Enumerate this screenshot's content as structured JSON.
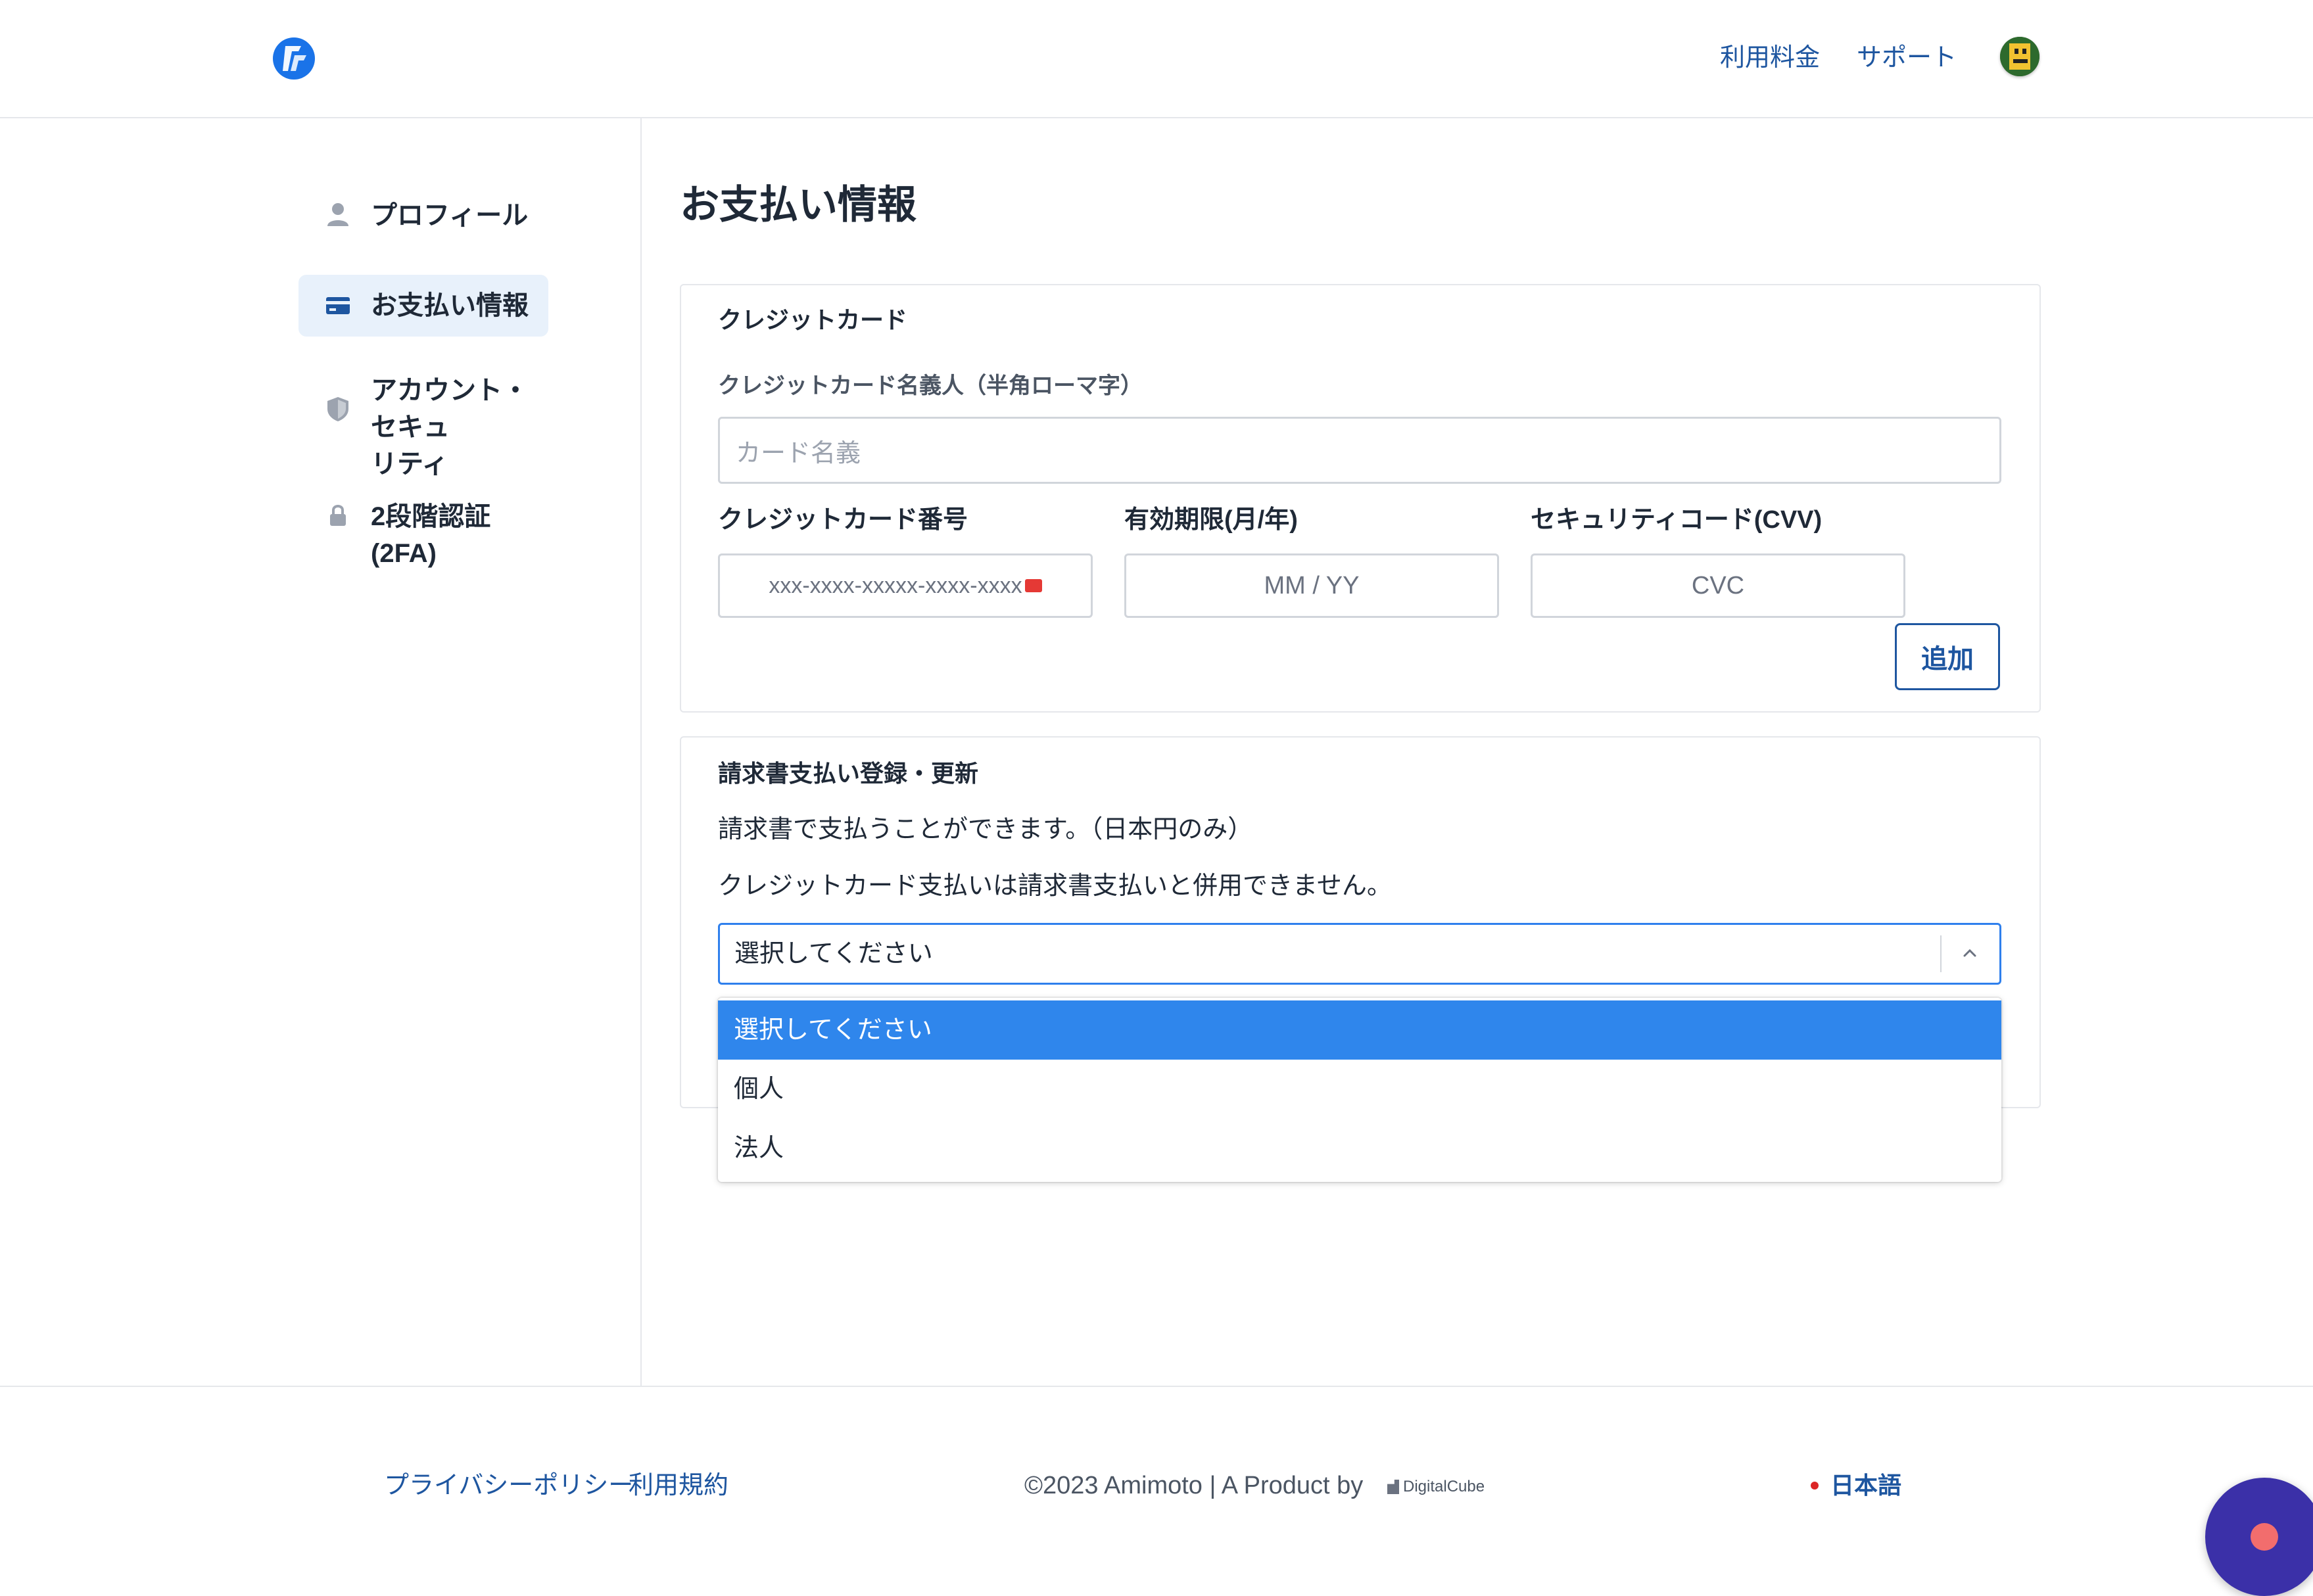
{
  "header": {
    "nav": [
      {
        "label": "利用料金"
      },
      {
        "label": "サポート"
      }
    ]
  },
  "sidebar": {
    "items": [
      {
        "label": "プロフィール",
        "icon": "user-icon",
        "active": false
      },
      {
        "label": "お支払い情報",
        "icon": "credit-card-icon",
        "active": true
      },
      {
        "label": "アカウント・セキュリティ",
        "line1": "アカウント・セキュ",
        "line2": "リティ",
        "icon": "shield-icon",
        "active": false
      },
      {
        "label": "2段階認証(2FA)",
        "icon": "lock-icon",
        "active": false
      }
    ]
  },
  "main": {
    "title": "お支払い情報",
    "credit_card": {
      "title": "クレジットカード",
      "name_label": "クレジットカード名義人（半角ローマ字）",
      "name_placeholder": "カード名義",
      "number_label": "クレジットカード番号",
      "number_placeholder": "xxx-xxxx-xxxxx-xxxx-xxxx",
      "expiry_label": "有効期限(月/年)",
      "expiry_placeholder": "MM / YY",
      "cvv_label": "セキュリティコード(CVV)",
      "cvv_placeholder": "CVC",
      "add_button": "追加"
    },
    "invoice": {
      "title": "請求書支払い登録・更新",
      "line1": "請求書で支払うことができます。（日本円のみ）",
      "line2": "クレジットカード支払いは請求書支払いと併用できません。",
      "select_value": "選択してください",
      "options": [
        {
          "label": "選択してください",
          "selected": true
        },
        {
          "label": "個人",
          "selected": false
        },
        {
          "label": "法人",
          "selected": false
        }
      ]
    }
  },
  "footer": {
    "privacy": "プライバシーポリシー",
    "terms": "利用規約",
    "copyright": "©2023 Amimoto | A Product by",
    "company": "DigitalCube",
    "language": "日本語"
  },
  "colors": {
    "accent": "#1e56a0",
    "selected_option": "#2f86ec",
    "chat_button": "#3b30a8"
  }
}
